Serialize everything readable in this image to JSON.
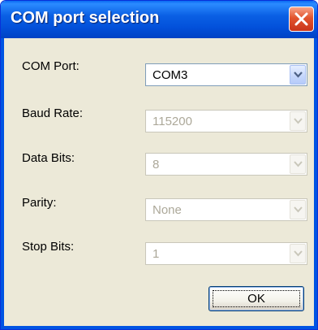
{
  "window": {
    "title": "COM port selection"
  },
  "fields": [
    {
      "label": "COM Port:",
      "value": "COM3",
      "enabled": true
    },
    {
      "label": "Baud Rate:",
      "value": "115200",
      "enabled": false
    },
    {
      "label": "Data Bits:",
      "value": "8",
      "enabled": false
    },
    {
      "label": "Parity:",
      "value": "None",
      "enabled": false
    },
    {
      "label": "Stop Bits:",
      "value": "1",
      "enabled": false
    }
  ],
  "buttons": {
    "ok_label": "OK"
  },
  "icons": {
    "close": "close-icon",
    "dropdown": "chevron-down-icon"
  },
  "colors": {
    "titlebar": "#0054e3",
    "close_button": "#e2542d",
    "dialog_background": "#ece9d8",
    "disabled_text": "#aca899"
  }
}
